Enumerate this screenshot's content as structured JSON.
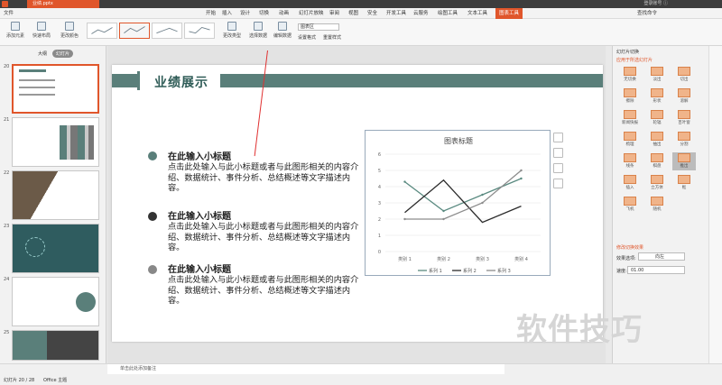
{
  "app": {
    "doc_tab": "业绩.pptx",
    "window_right_text": "登录账号 ⓘ"
  },
  "menu": {
    "file": "文件",
    "items": [
      "开始",
      "插入",
      "设计",
      "切换",
      "动画",
      "幻灯片放映",
      "审阅",
      "视图",
      "安全",
      "开发工具",
      "云服务",
      "绘图工具",
      "文本工具",
      "图表工具"
    ],
    "active": "图表工具",
    "search": "查找命令"
  },
  "ribbon": {
    "add_element": "添加元素",
    "quick_layout": "快速布局",
    "change_color": "更改颜色",
    "change_type": "更改类型",
    "select_data": "选择数据",
    "edit_data": "编辑数据",
    "chart_area": "图表区",
    "format": "设置格式",
    "reset_style": "重置样式"
  },
  "sidebar": {
    "tab_outline": "大纲",
    "tab_slides": "幻灯片",
    "slide_numbers": [
      "20",
      "21",
      "22",
      "23",
      "24",
      "25"
    ]
  },
  "slide": {
    "title": "业绩展示",
    "items": [
      {
        "heading": "在此输入小标题",
        "body": "点击此处输入与此小标题或者与此图形相关的内容介绍、数据统计、事件分析、总结概述等文字描述内容。",
        "color": "#5a7f7a"
      },
      {
        "heading": "在此输入小标题",
        "body": "点击此处输入与此小标题或者与此图形相关的内容介绍、数据统计、事件分析、总结概述等文字描述内容。",
        "color": "#333333"
      },
      {
        "heading": "在此输入小标题",
        "body": "点击此处输入与此小标题或者与此图形相关的内容介绍、数据统计、事件分析、总结概述等文字描述内容。",
        "color": "#888888"
      }
    ]
  },
  "chart_data": {
    "type": "line",
    "title": "图表标题",
    "categories": [
      "类别 1",
      "类别 2",
      "类别 3",
      "类别 4"
    ],
    "series": [
      {
        "name": "系列 1",
        "values": [
          4.3,
          2.5,
          3.5,
          4.5
        ],
        "color": "#5a8a80"
      },
      {
        "name": "系列 2",
        "values": [
          2.4,
          4.4,
          1.8,
          2.8
        ],
        "color": "#2b2b2b"
      },
      {
        "name": "系列 3",
        "values": [
          2.0,
          2.0,
          3.0,
          5.0
        ],
        "color": "#8c8c8c"
      }
    ],
    "ylim": [
      0,
      6
    ],
    "yticks": [
      "0",
      "1",
      "2",
      "3",
      "4",
      "5",
      "6"
    ],
    "grid": true,
    "legend": "bottom"
  },
  "right_panel": {
    "header": "幻灯片切换",
    "apply_label": "应用于所选幻灯片",
    "transitions": [
      "无切换",
      "淡出",
      "切出",
      "擦除",
      "形状",
      "溶解",
      "新闻快报",
      "轮辐",
      "百叶窗",
      "梳理",
      "抽出",
      "分割",
      "线条",
      "棋盘",
      "推出",
      "插入",
      "立方体",
      "框",
      "飞机",
      "随机"
    ],
    "selected": "推出",
    "modify_label": "修改切换效果",
    "effect_label": "效果选项:",
    "effect_value": "向左",
    "speed_label": "速度:",
    "speed_value": "01.00"
  },
  "status": {
    "slide_info": "幻灯片 20 / 28",
    "theme": "Office 主题",
    "notes_placeholder": "单击此处添加备注"
  },
  "watermark": "软件技巧"
}
